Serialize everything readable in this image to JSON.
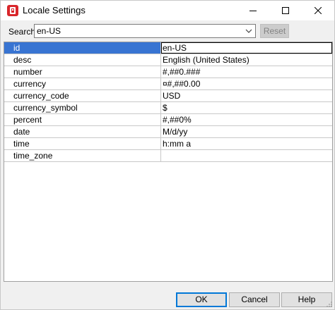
{
  "window": {
    "title": "Locale Settings",
    "app_icon": "red-app-icon",
    "controls": [
      "minimize-icon",
      "maximize-icon",
      "close-icon"
    ]
  },
  "search": {
    "label": "Search",
    "value": "en-US",
    "reset_label": "Reset",
    "reset_enabled": false
  },
  "table": {
    "selected_row": 0,
    "rows": [
      {
        "key": "id",
        "value": "en-US"
      },
      {
        "key": "desc",
        "value": "English (United States)"
      },
      {
        "key": "number",
        "value": "#,##0.###"
      },
      {
        "key": "currency",
        "value": "¤#,##0.00"
      },
      {
        "key": "currency_code",
        "value": "USD"
      },
      {
        "key": "currency_symbol",
        "value": "$"
      },
      {
        "key": "percent",
        "value": "#,##0%"
      },
      {
        "key": "date",
        "value": "M/d/yy"
      },
      {
        "key": "time",
        "value": "h:mm a"
      },
      {
        "key": "time_zone",
        "value": ""
      }
    ]
  },
  "buttons": {
    "ok": "OK",
    "cancel": "Cancel",
    "help": "Help"
  },
  "colors": {
    "selection": "#3874d2",
    "app_icon": "#d9262b",
    "default_button_border": "#0078d7"
  }
}
